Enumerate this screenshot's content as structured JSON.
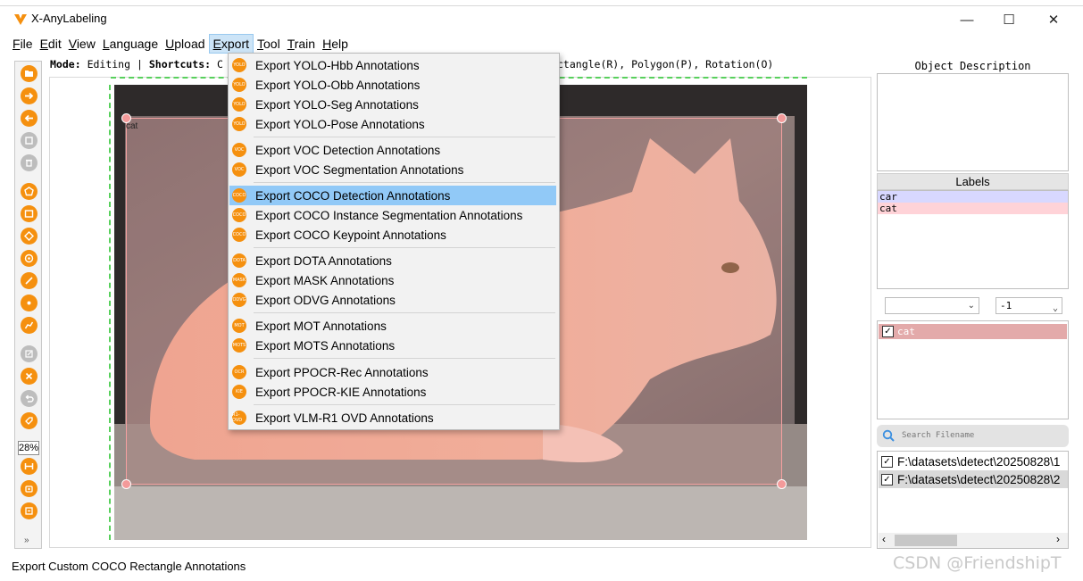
{
  "window": {
    "title": "X-AnyLabeling",
    "logo_color": "#f5900f",
    "controls": {
      "minimize": "—",
      "maximize": "☐",
      "close": "✕"
    }
  },
  "menubar": {
    "items": [
      {
        "label": "File",
        "key": "F",
        "rest": "ile"
      },
      {
        "label": "Edit",
        "key": "E",
        "rest": "dit"
      },
      {
        "label": "View",
        "key": "V",
        "rest": "iew"
      },
      {
        "label": "Language",
        "key": "L",
        "rest": "anguage"
      },
      {
        "label": "Upload",
        "key": "U",
        "rest": "pload"
      },
      {
        "label": "Export",
        "key": "E",
        "rest": "xport",
        "active": true
      },
      {
        "label": "Tool",
        "key": "T",
        "rest": "ool"
      },
      {
        "label": "Train",
        "key": "T",
        "rest": "rain"
      },
      {
        "label": "Help",
        "key": "H",
        "rest": "elp"
      }
    ]
  },
  "modebar": {
    "mode_key": "Mode:",
    "mode_value": "Editing",
    "shortcuts_key": "Shortcuts:",
    "shortcuts_start": "C",
    "shortcuts_visible_end": "ctangle(R), Polygon(P), Rotation(O)"
  },
  "toolbar": {
    "zoom_value": "28%",
    "more": "»",
    "accent": "#f5900f",
    "disabled": "#bdbdbd"
  },
  "canvas": {
    "bbox_label": "cat",
    "bbox_color": "#f3a0a0",
    "guide_color": "#58d05c"
  },
  "export_menu": {
    "items": [
      {
        "label": "Export YOLO-Hbb Annotations",
        "icon": "YOLO"
      },
      {
        "label": "Export YOLO-Obb Annotations",
        "icon": "YOLO"
      },
      {
        "label": "Export YOLO-Seg Annotations",
        "icon": "YOLO"
      },
      {
        "label": "Export YOLO-Pose Annotations",
        "icon": "YOLO"
      },
      {
        "label": "Export VOC Detection Annotations",
        "icon": "VOC"
      },
      {
        "label": "Export VOC Segmentation Annotations",
        "icon": "VOC"
      },
      {
        "label": "Export COCO Detection Annotations",
        "icon": "COCO",
        "highlighted": true
      },
      {
        "label": "Export COCO Instance Segmentation Annotations",
        "icon": "COCO"
      },
      {
        "label": "Export COCO Keypoint Annotations",
        "icon": "COCO"
      },
      {
        "label": "Export DOTA Annotations",
        "icon": "DOTA"
      },
      {
        "label": "Export MASK Annotations",
        "icon": "MASK"
      },
      {
        "label": "Export ODVG Annotations",
        "icon": "ODVG"
      },
      {
        "label": "Export MOT Annotations",
        "icon": "MOT"
      },
      {
        "label": "Export MOTS Annotations",
        "icon": "MOTS"
      },
      {
        "label": "Export PPOCR-Rec Annotations",
        "icon": "OCR"
      },
      {
        "label": "Export PPOCR-KIE Annotations",
        "icon": "KIE"
      },
      {
        "label": "Export VLM-R1 OVD Annotations",
        "icon": "R1-OVD"
      }
    ],
    "highlight_color": "#91c9f7"
  },
  "right_panel": {
    "description_title": "Object Description",
    "labels_title": "Labels",
    "labels": [
      {
        "name": "car",
        "color": "#d8d8ff"
      },
      {
        "name": "cat",
        "color": "#ffd3d8"
      }
    ],
    "combo_left": "",
    "combo_right": "-1",
    "shapes": [
      {
        "label": "cat",
        "checked": true,
        "color": "#e3aaaa"
      }
    ],
    "search_placeholder": "Search Filename",
    "files": [
      {
        "path": "F:\\datasets\\detect\\20250828\\1",
        "checked": true
      },
      {
        "path": "F:\\datasets\\detect\\20250828\\2",
        "checked": true,
        "selected": true
      }
    ]
  },
  "statusbar": {
    "text": "Export Custom COCO Rectangle Annotations"
  },
  "watermark": "CSDN @FriendshipT"
}
